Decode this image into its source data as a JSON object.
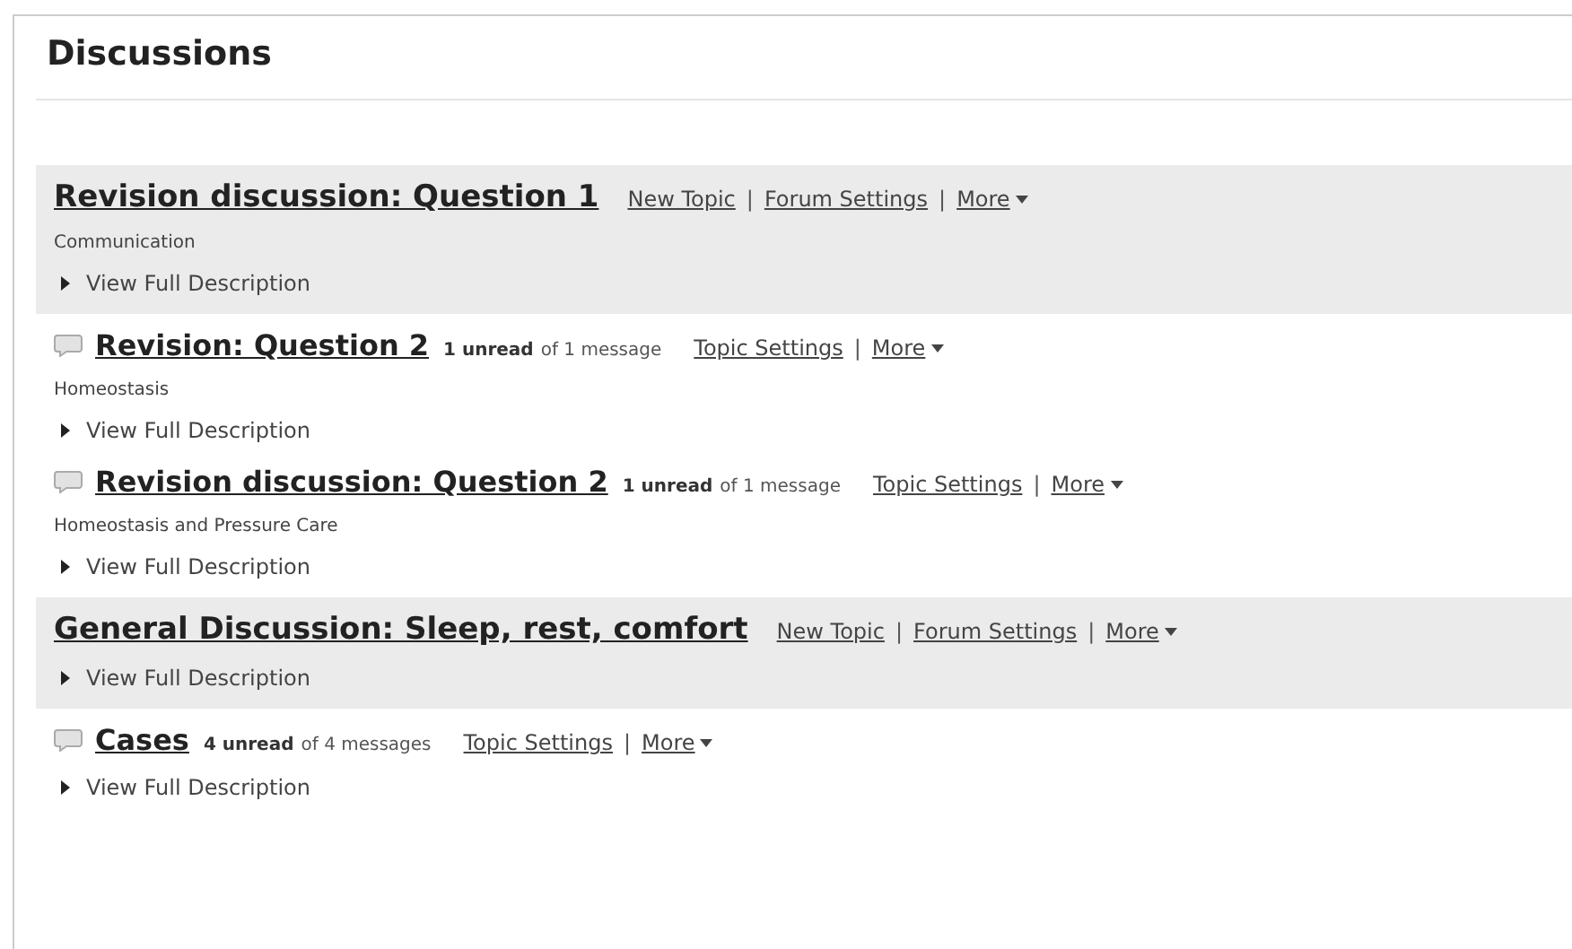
{
  "page_title": "Discussions",
  "items": [
    {
      "kind": "forum",
      "title": "Revision discussion: Question 1",
      "links": [
        {
          "kind": "link",
          "text": "New Topic"
        },
        {
          "kind": "separator",
          "text": "|"
        },
        {
          "kind": "link",
          "text": "Forum Settings"
        },
        {
          "kind": "separator",
          "text": "|"
        },
        {
          "kind": "menu",
          "text": "More"
        }
      ],
      "description": "Communication",
      "toggle": "View Full Description"
    },
    {
      "kind": "topic",
      "title": "Revision: Question 2",
      "unread": "1 unread",
      "count": "of 1 message",
      "links": [
        {
          "kind": "link",
          "text": "Topic Settings"
        },
        {
          "kind": "separator",
          "text": "|"
        },
        {
          "kind": "menu",
          "text": "More"
        }
      ],
      "description": "Homeostasis",
      "toggle": "View Full Description"
    },
    {
      "kind": "topic",
      "title": "Revision discussion: Question 2",
      "unread": "1 unread",
      "count": "of 1 message",
      "links": [
        {
          "kind": "link",
          "text": "Topic Settings"
        },
        {
          "kind": "separator",
          "text": "|"
        },
        {
          "kind": "menu",
          "text": "More"
        }
      ],
      "description": "Homeostasis and Pressure Care",
      "toggle": "View Full Description"
    },
    {
      "kind": "forum",
      "title": "General Discussion: Sleep, rest, comfort",
      "links": [
        {
          "kind": "link",
          "text": "New Topic"
        },
        {
          "kind": "separator",
          "text": "|"
        },
        {
          "kind": "link",
          "text": "Forum Settings"
        },
        {
          "kind": "separator",
          "text": "|"
        },
        {
          "kind": "menu",
          "text": "More"
        }
      ],
      "toggle": "View Full Description"
    },
    {
      "kind": "topic",
      "title": "Cases",
      "unread": "4 unread",
      "count": "of 4 messages",
      "links": [
        {
          "kind": "link",
          "text": "Topic Settings"
        },
        {
          "kind": "separator",
          "text": "|"
        },
        {
          "kind": "menu",
          "text": "More"
        }
      ],
      "toggle": "View Full Description"
    }
  ]
}
